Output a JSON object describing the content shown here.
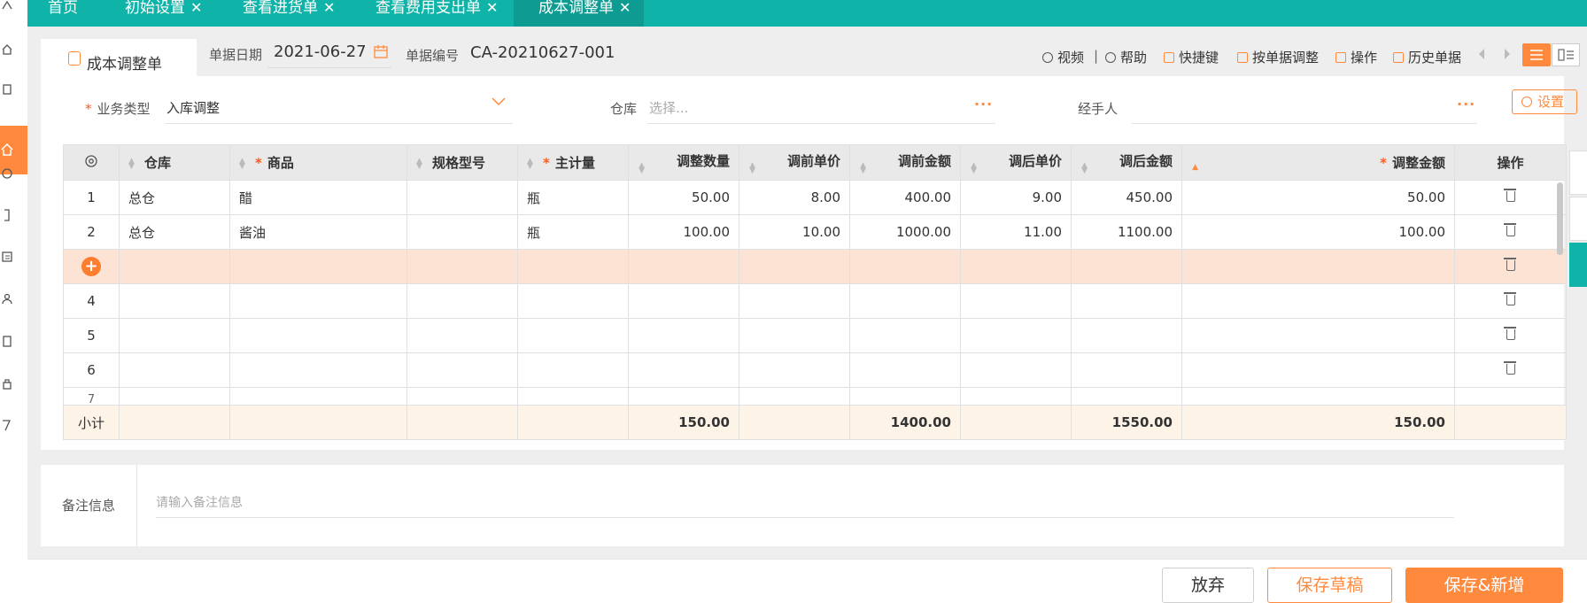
{
  "tabs": [
    {
      "label": "首页",
      "closable": false
    },
    {
      "label": "初始设置",
      "closable": true
    },
    {
      "label": "查看进货单",
      "closable": true
    },
    {
      "label": "查看费用支出单",
      "closable": true
    },
    {
      "label": "成本调整单",
      "closable": true,
      "active": true
    }
  ],
  "doc": {
    "tab_title": "成本调整单",
    "date_label": "单据日期",
    "date_value": "2021-06-27",
    "number_label": "单据编号",
    "number_value": "CA-20210627-001"
  },
  "toolbar": {
    "video": "视频",
    "separator": "|",
    "help": "帮助",
    "shortcut": "快捷键",
    "adjust_by_doc": "按单据调整",
    "operate": "操作",
    "history": "历史单据"
  },
  "form": {
    "biz_type_label": "业务类型",
    "biz_type_value": "入库调整",
    "warehouse_label": "仓库",
    "warehouse_placeholder": "选择...",
    "handler_label": "经手人",
    "settings_label": "设置",
    "dots": "···"
  },
  "table": {
    "headers": {
      "warehouse": "仓库",
      "product": "商品",
      "spec": "规格型号",
      "unit": "主计量",
      "adj_qty": "调整数量",
      "price_before": "调前单价",
      "amount_before": "调前金额",
      "price_after": "调后单价",
      "amount_after": "调后金额",
      "adj_amount": "调整金额",
      "ops": "操作"
    },
    "rows": [
      {
        "no": "1",
        "warehouse": "总仓",
        "product": "醋",
        "spec": "",
        "unit": "瓶",
        "adj_qty": "50.00",
        "price_before": "8.00",
        "amount_before": "400.00",
        "price_after": "9.00",
        "amount_after": "450.00",
        "adj_amount": "50.00"
      },
      {
        "no": "2",
        "warehouse": "总仓",
        "product": "酱油",
        "spec": "",
        "unit": "瓶",
        "adj_qty": "100.00",
        "price_before": "10.00",
        "amount_before": "1000.00",
        "price_after": "11.00",
        "amount_after": "1100.00",
        "adj_amount": "100.00"
      },
      {
        "no": "4"
      },
      {
        "no": "5"
      },
      {
        "no": "6"
      },
      {
        "no": "7"
      }
    ],
    "subtotal": {
      "label": "小计",
      "adj_qty": "150.00",
      "amount_before": "1400.00",
      "amount_after": "1550.00",
      "adj_amount": "150.00"
    }
  },
  "remark": {
    "label": "备注信息",
    "placeholder": "请输入备注信息"
  },
  "footer": {
    "discard": "放弃",
    "save_draft": "保存草稿",
    "save_new": "保存&新增"
  },
  "colors": {
    "teal": "#10b3a8",
    "orange": "#ff8a3d",
    "highlight_row": "#fde3d3",
    "subtotal_row": "#fdf3e6"
  }
}
